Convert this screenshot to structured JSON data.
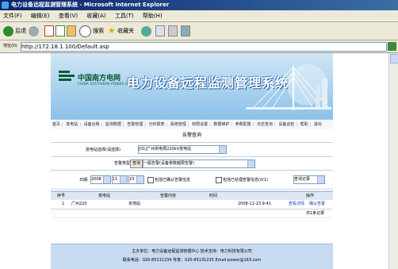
{
  "window": {
    "title": "电力设备远程监测管理系统 - Microsoft Internet Explorer"
  },
  "menu": [
    "文件(F)",
    "编辑(E)",
    "查看(V)",
    "收藏(A)",
    "工具(T)",
    "帮助(H)"
  ],
  "toolbar": {
    "back_label": "后退",
    "search_label": "搜索",
    "favorites_label": "收藏夹"
  },
  "address": {
    "label": "地址(D)",
    "url": "http://172.18.1.100/Default.asp"
  },
  "banner": {
    "logo_cn": "中国南方电网",
    "logo_en": "CHINA SOUTHERN POWER GRID",
    "title": "电力设备远程监测管理系统"
  },
  "nav": [
    "首页",
    "变电站",
    "设备台账",
    "监测数据",
    "告警管理",
    "分析报表",
    "系统管理",
    "权限设置",
    "数据维护",
    "参数配置",
    "日志查询",
    "设备巡检",
    "帮助",
    "退出"
  ],
  "section_title": "告警查询",
  "filters": {
    "station_label": "变电站选择(请选择)",
    "station_value": "[01]广州供电局220kV变电站",
    "type_label": "告警类型",
    "type_button": "查询",
    "type_option": "一般告警(设备参数越限告警)",
    "date_label": "日期:",
    "year": "2008",
    "month": "11",
    "day": "23",
    "check1": "包括已确认告警信息",
    "check2": "包括已处理告警信息(0/1)",
    "query_button": "查询记录"
  },
  "table": {
    "headers": [
      "序号",
      "变电站",
      "告警内容",
      "时间",
      "操作"
    ],
    "rows": [
      {
        "no": "1",
        "station": "广州220",
        "content": "本地站",
        "time": "2008-11-23 9:41",
        "action1": "查看详情",
        "action2": "确认告警"
      }
    ],
    "footer": "共1条记录"
  },
  "footer": {
    "line1": "主办单位：电力设备远程监测管理中心  技术支持：电力科技有限公司",
    "line2": "联系电话：020-85131234  传真：020-85131235  Email:power@163.com"
  },
  "colors": {
    "titlebar": "#0a246a",
    "banner": "#a9d1ee",
    "logo_green": "#0a5a32",
    "footer": "#c7daf0"
  }
}
